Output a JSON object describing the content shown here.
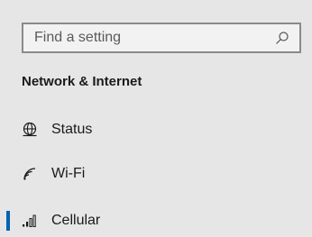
{
  "search": {
    "placeholder": "Find a setting",
    "icon": "search-icon"
  },
  "section": {
    "title": "Network & Internet"
  },
  "nav": {
    "items": [
      {
        "label": "Status",
        "icon": "globe-icon",
        "selected": false
      },
      {
        "label": "Wi-Fi",
        "icon": "wifi-icon",
        "selected": false
      },
      {
        "label": "Cellular",
        "icon": "cellular-icon",
        "selected": true
      }
    ]
  },
  "colors": {
    "background": "#e6e6e6",
    "accent": "#0063b1",
    "search_border": "#8a8a8a"
  }
}
